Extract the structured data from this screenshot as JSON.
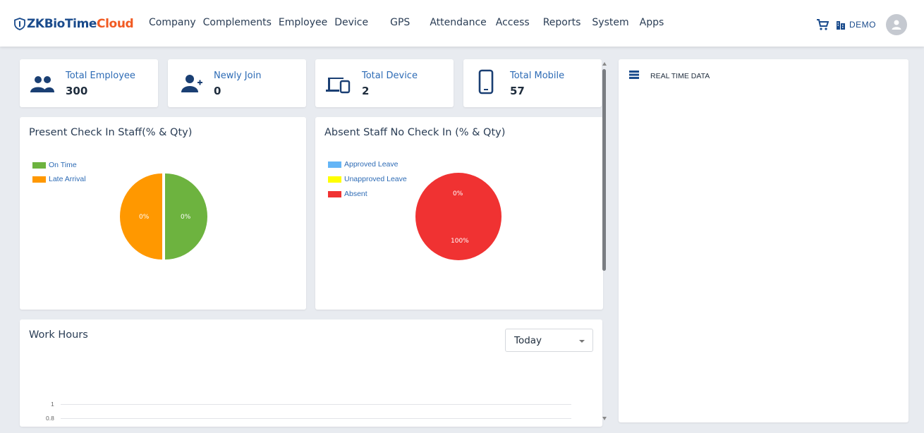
{
  "brand": {
    "name_part1": "ZKBio",
    "name_part2": "Time",
    "name_part3": "Cloud",
    "accent": "#f15a22",
    "primary": "#1a4b8c"
  },
  "nav": [
    "Company",
    "Complements",
    "Employee",
    "Device",
    "GPS",
    "Attendance",
    "Access",
    "Reports",
    "System",
    "Apps"
  ],
  "header_tools": {
    "cart_icon": "cart-icon",
    "company_icon": "building-icon",
    "company_label": "DEMO",
    "avatar_icon": "user-avatar-icon"
  },
  "stats": [
    {
      "label": "Total Employee",
      "value": "300",
      "icon": "people-icon"
    },
    {
      "label": "Newly Join",
      "value": "0",
      "icon": "user-plus-icon"
    },
    {
      "label": "Total Device",
      "value": "2",
      "icon": "devices-icon"
    },
    {
      "label": "Total Mobile",
      "value": "57",
      "icon": "mobile-icon"
    }
  ],
  "present": {
    "title": "Present Check In Staff(% & Qty)",
    "legend": [
      {
        "label": "On Time",
        "color": "#6db33f"
      },
      {
        "label": "Late Arrival",
        "color": "#ff9800"
      }
    ],
    "labels": [
      "0%",
      "0%"
    ]
  },
  "absent": {
    "title": "Absent Staff No Check In (% & Qty)",
    "legend": [
      {
        "label": "Approved Leave",
        "color": "#64b5f6"
      },
      {
        "label": "Unapproved Leave",
        "color": "#ffff00"
      },
      {
        "label": "Absent",
        "color": "#f03232"
      }
    ],
    "labels": [
      "0%",
      "100%"
    ]
  },
  "realtime": {
    "title": "REAL TIME DATA",
    "icon": "list-icon"
  },
  "work_hours": {
    "title": "Work Hours",
    "period": "Today",
    "y_ticks": [
      "1",
      "0.8"
    ]
  }
}
